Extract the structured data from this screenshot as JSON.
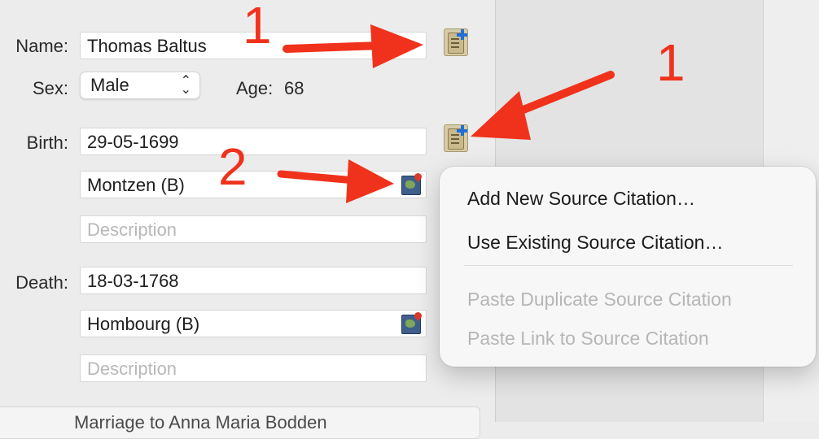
{
  "form": {
    "name_label": "Name:",
    "name_value": "Thomas Baltus",
    "sex_label": "Sex:",
    "sex_value": "Male",
    "age_label": "Age:",
    "age_value": "68",
    "birth_label": "Birth:",
    "birth_date": "29-05-1699",
    "birth_place": "Montzen (B)",
    "birth_description_placeholder": "Description",
    "death_label": "Death:",
    "death_date": "18-03-1768",
    "death_place": "Hombourg (B)",
    "death_description_placeholder": "Description",
    "marriage_tab": "Marriage to Anna Maria Bodden"
  },
  "annotations": {
    "number_one_a": "1",
    "number_one_b": "1",
    "number_two": "2",
    "color": "#f0321c"
  },
  "context_menu": {
    "items": [
      {
        "label": "Add New Source Citation…",
        "enabled": true
      },
      {
        "label": "Use Existing Source Citation…",
        "enabled": true
      },
      {
        "label": "Paste Duplicate Source Citation",
        "enabled": false
      },
      {
        "label": "Paste Link to Source Citation",
        "enabled": false
      }
    ]
  },
  "icons": {
    "source_citation": "source-citation-icon",
    "place_map": "map-icon",
    "popup_chevron": "chevron-updown-icon"
  }
}
